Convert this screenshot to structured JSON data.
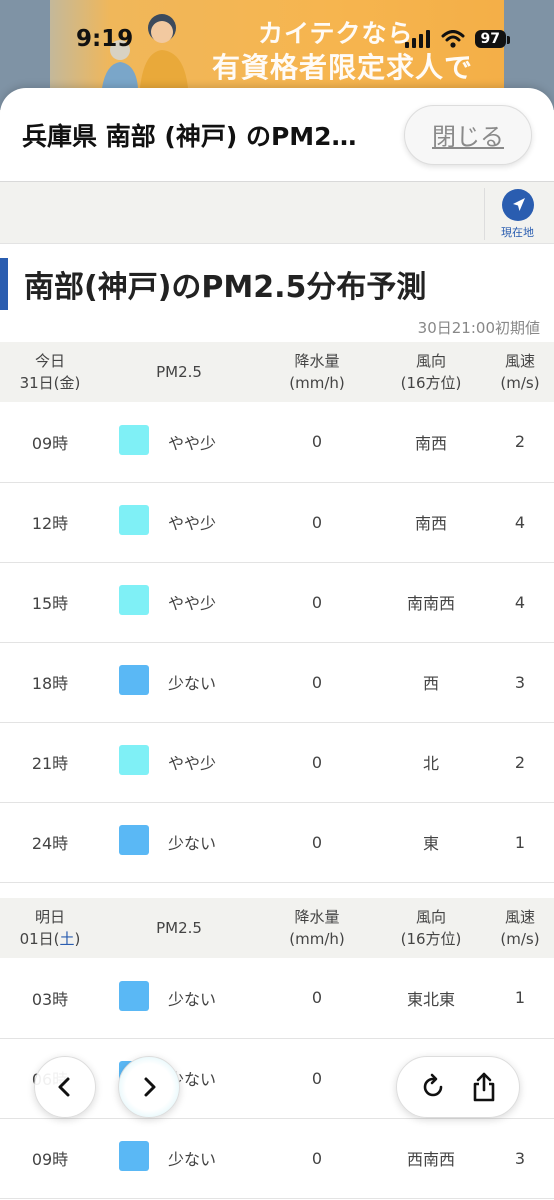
{
  "status_bar": {
    "time": "9:19",
    "battery": "97"
  },
  "ad": {
    "line1": "カイテクなら",
    "line2": "有資格者限定求人で"
  },
  "sheet": {
    "title": "兵庫県 南部 (神戸) のPM2…",
    "close_label": "閉じる"
  },
  "location": {
    "label": "現在地"
  },
  "section": {
    "title": "南部(神戸)のPM2.5分布予測",
    "init_time": "30日21:00初期値"
  },
  "colors": {
    "accent": "#2a5db0",
    "slightly_low": "#7ff0f6",
    "low": "#5ab8f5"
  },
  "days": [
    {
      "day_label": "今日",
      "date_prefix": "31日(",
      "weekday": "金",
      "date_suffix": ")",
      "col_pm": "PM2.5",
      "col_rain_1": "降水量",
      "col_rain_2": "(mm/h)",
      "col_dir_1": "風向",
      "col_dir_2": "(16方位)",
      "col_speed_1": "風速",
      "col_speed_2": "(m/s)",
      "rows": [
        {
          "time": "09時",
          "level": "やや少",
          "rain": "0",
          "dir": "南西",
          "speed": "2"
        },
        {
          "time": "12時",
          "level": "やや少",
          "rain": "0",
          "dir": "南西",
          "speed": "4"
        },
        {
          "time": "15時",
          "level": "やや少",
          "rain": "0",
          "dir": "南南西",
          "speed": "4"
        },
        {
          "time": "18時",
          "level": "少ない",
          "rain": "0",
          "dir": "西",
          "speed": "3"
        },
        {
          "time": "21時",
          "level": "やや少",
          "rain": "0",
          "dir": "北",
          "speed": "2"
        },
        {
          "time": "24時",
          "level": "少ない",
          "rain": "0",
          "dir": "東",
          "speed": "1"
        }
      ]
    },
    {
      "day_label": "明日",
      "date_prefix": "01日(",
      "weekday": "土",
      "date_suffix": ")",
      "col_pm": "PM2.5",
      "col_rain_1": "降水量",
      "col_rain_2": "(mm/h)",
      "col_dir_1": "風向",
      "col_dir_2": "(16方位)",
      "col_speed_1": "風速",
      "col_speed_2": "(m/s)",
      "rows": [
        {
          "time": "03時",
          "level": "少ない",
          "rain": "0",
          "dir": "東北東",
          "speed": "1"
        },
        {
          "time": "06時",
          "level": "少ない",
          "rain": "0",
          "dir": "",
          "speed": ""
        },
        {
          "time": "09時",
          "level": "少ない",
          "rain": "0",
          "dir": "西南西",
          "speed": "3"
        }
      ]
    }
  ],
  "nav": {
    "back_icon": "chevron-left-icon",
    "forward_icon": "chevron-right-icon",
    "reload_icon": "reload-icon",
    "share_icon": "share-icon"
  }
}
